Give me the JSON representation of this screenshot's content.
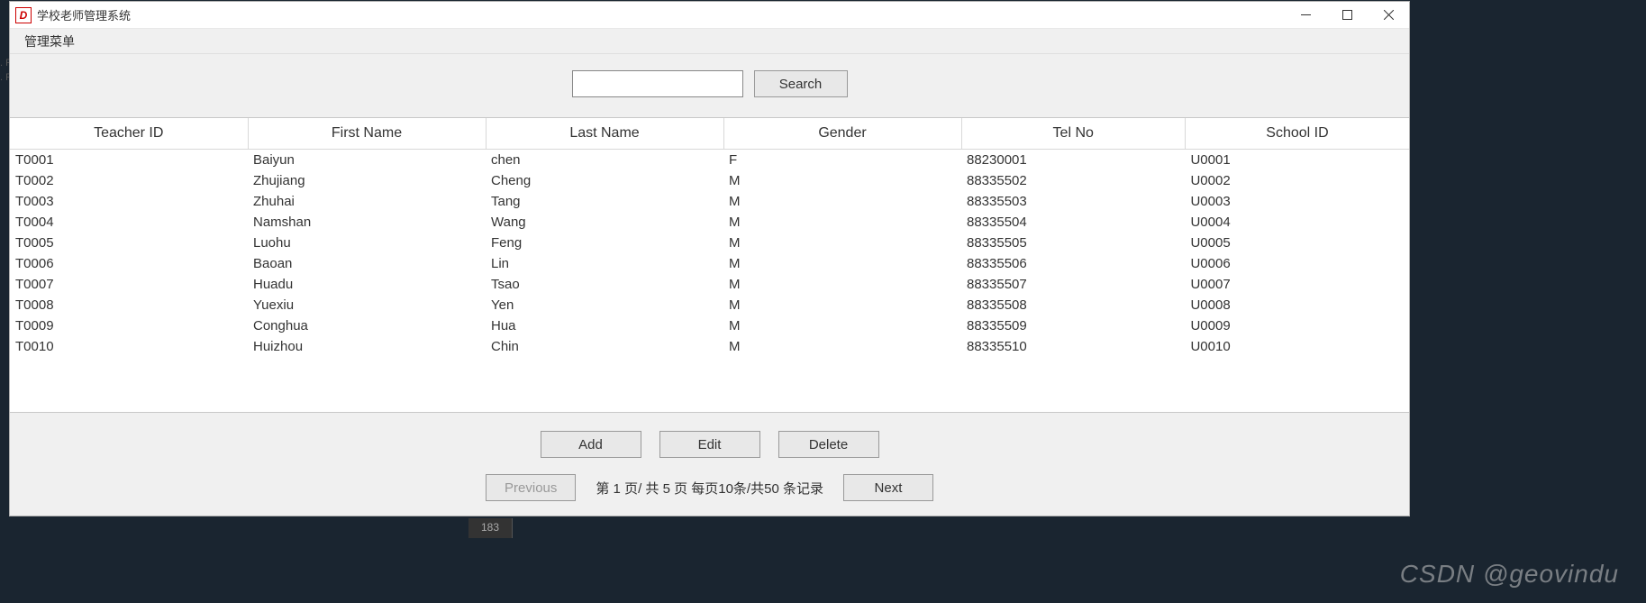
{
  "window": {
    "title": "学校老师管理系统",
    "app_icon_letter": "D"
  },
  "menubar": {
    "items": [
      "管理菜单"
    ]
  },
  "search": {
    "value": "",
    "button_label": "Search"
  },
  "table": {
    "headers": [
      "Teacher ID",
      "First Name",
      "Last Name",
      "Gender",
      "Tel No",
      "School ID"
    ],
    "rows": [
      {
        "teacher_id": "T0001",
        "first_name": "Baiyun",
        "last_name": "chen",
        "gender": "F",
        "tel_no": "88230001",
        "school_id": "U0001"
      },
      {
        "teacher_id": "T0002",
        "first_name": "Zhujiang",
        "last_name": "Cheng",
        "gender": "M",
        "tel_no": "88335502",
        "school_id": "U0002"
      },
      {
        "teacher_id": "T0003",
        "first_name": "Zhuhai",
        "last_name": "Tang",
        "gender": "M",
        "tel_no": "88335503",
        "school_id": "U0003"
      },
      {
        "teacher_id": "T0004",
        "first_name": "Namshan",
        "last_name": "Wang",
        "gender": "M",
        "tel_no": "88335504",
        "school_id": "U0004"
      },
      {
        "teacher_id": "T0005",
        "first_name": "Luohu",
        "last_name": "Feng",
        "gender": "M",
        "tel_no": "88335505",
        "school_id": "U0005"
      },
      {
        "teacher_id": "T0006",
        "first_name": "Baoan",
        "last_name": "Lin",
        "gender": "M",
        "tel_no": "88335506",
        "school_id": "U0006"
      },
      {
        "teacher_id": "T0007",
        "first_name": "Huadu",
        "last_name": "Tsao",
        "gender": "M",
        "tel_no": "88335507",
        "school_id": "U0007"
      },
      {
        "teacher_id": "T0008",
        "first_name": "Yuexiu",
        "last_name": "Yen",
        "gender": "M",
        "tel_no": "88335508",
        "school_id": "U0008"
      },
      {
        "teacher_id": "T0009",
        "first_name": "Conghua",
        "last_name": "Hua",
        "gender": "M",
        "tel_no": "88335509",
        "school_id": "U0009"
      },
      {
        "teacher_id": "T0010",
        "first_name": "Huizhou",
        "last_name": "Chin",
        "gender": "M",
        "tel_no": "88335510",
        "school_id": "U0010"
      }
    ]
  },
  "actions": {
    "add_label": "Add",
    "edit_label": "Edit",
    "delete_label": "Delete"
  },
  "pagination": {
    "prev_label": "Previous",
    "next_label": "Next",
    "info": "第 1 页/ 共 5 页 每页10条/共50 条记录",
    "prev_disabled": true
  },
  "watermark": "CSDN @geovindu",
  "side_markers": [
    ". P",
    ". P"
  ],
  "bottom_chip": "183"
}
